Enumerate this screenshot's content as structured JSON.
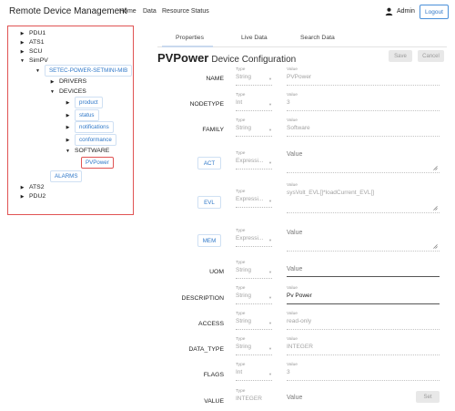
{
  "navbar": {
    "brand": "Remote Device Management",
    "links": [
      "Home",
      "Data",
      "Resource Status"
    ],
    "user": "Admin",
    "logout": "Logout"
  },
  "tree": {
    "pdu1": "PDU1",
    "ats1": "ATS1",
    "scu": "SCU",
    "simpv": "SimPV",
    "mib": "SETEC-POWER-SETMINI-MIB",
    "drivers": "DRIVERS",
    "devices": "DEVICES",
    "product": "product",
    "status": "status",
    "notifications": "notifications",
    "conformance": "conformance",
    "software": "SOFTWARE",
    "pvpower": "PVPower",
    "alarms": "ALARMS",
    "ats2": "ATS2",
    "pdu2": "PDU2"
  },
  "tabs": [
    "Properties",
    "Live Data",
    "Search Data"
  ],
  "title": {
    "name": "PVPower",
    "subtitle": "Device Configuration"
  },
  "actions": {
    "save": "Save",
    "cancel": "Cancel",
    "set": "Set"
  },
  "captions": {
    "type": "Type",
    "value": "Value"
  },
  "form": {
    "name": {
      "label": "NAME",
      "type": "String",
      "value": "PVPower"
    },
    "nodetype": {
      "label": "NODETYPE",
      "type": "Int",
      "value": "3"
    },
    "family": {
      "label": "FAMILY",
      "type": "String",
      "value": "Software"
    },
    "act": {
      "label": "ACT",
      "type": "Expressi...",
      "value": ""
    },
    "evl": {
      "label": "EVL",
      "type": "Expressi...",
      "value": "sysVolt_EVL[]*loadCurrent_EVL[]"
    },
    "mem": {
      "label": "MEM",
      "type": "Expressi...",
      "value": ""
    },
    "uom": {
      "label": "UOM",
      "type": "String",
      "value": ""
    },
    "description": {
      "label": "DESCRIPTION",
      "type": "String",
      "value": "Pv Power"
    },
    "access": {
      "label": "ACCESS",
      "type": "String",
      "value": "read-only"
    },
    "data_type": {
      "label": "DATA_TYPE",
      "type": "String",
      "value": "INTEGER"
    },
    "flags": {
      "label": "FLAGS",
      "type": "Int",
      "value": "3"
    },
    "value": {
      "label": "VALUE",
      "type": "INTEGER",
      "value": ""
    }
  }
}
